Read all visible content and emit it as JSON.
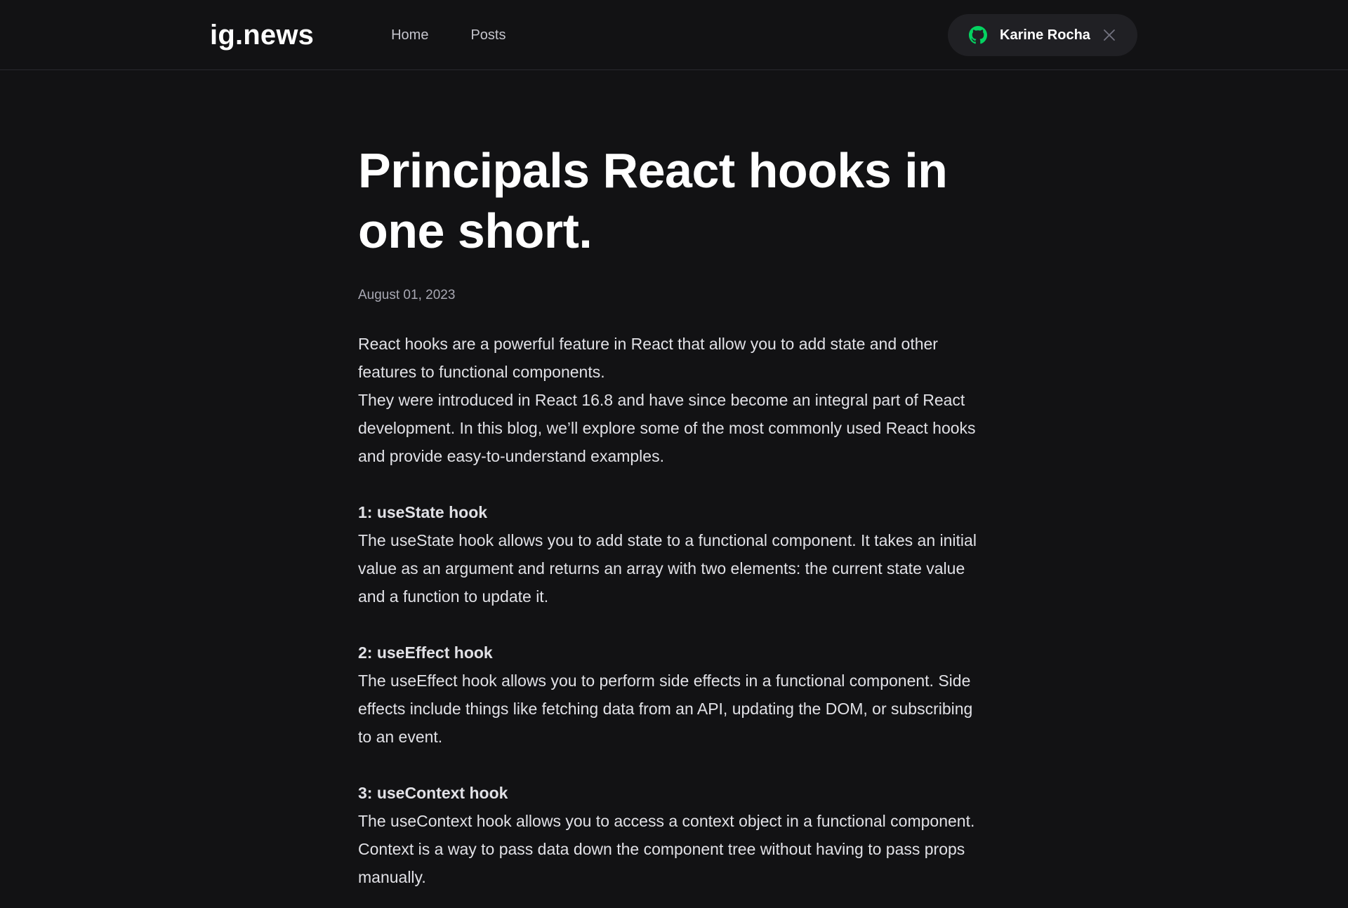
{
  "header": {
    "logo": "ig.news",
    "nav": [
      {
        "label": "Home"
      },
      {
        "label": "Posts"
      }
    ],
    "user": {
      "name": "Karine Rocha",
      "icon": "github-icon",
      "close_icon": "close-icon",
      "icon_color": "#04d361"
    }
  },
  "post": {
    "title": "Principals React hooks in one short.",
    "date": "August 01, 2023",
    "intro": [
      "React hooks are a powerful feature in React that allow you to add state and other features to functional components.",
      "They were introduced in React 16.8 and have since become an integral part of React development. In this blog, we’ll explore some of the most commonly used React hooks and provide easy-to-understand examples."
    ],
    "sections": [
      {
        "heading": "1: useState hook",
        "body": "The useState hook allows you to add state to a functional component. It takes an initial value as an argument and returns an array with two elements: the current state value and a function to update it."
      },
      {
        "heading": "2: useEffect hook",
        "body": "The useEffect hook allows you to perform side effects in a functional component. Side effects include things like fetching data from an API, updating the DOM, or subscribing to an event."
      },
      {
        "heading": "3: useContext hook",
        "body": "The useContext hook allows you to access a context object in a functional component. Context is a way to pass data down the component tree without having to pass props manually."
      }
    ]
  },
  "colors": {
    "background": "#121214",
    "header_border": "#29292e",
    "button_bg": "#202024",
    "accent_green": "#04d361"
  }
}
